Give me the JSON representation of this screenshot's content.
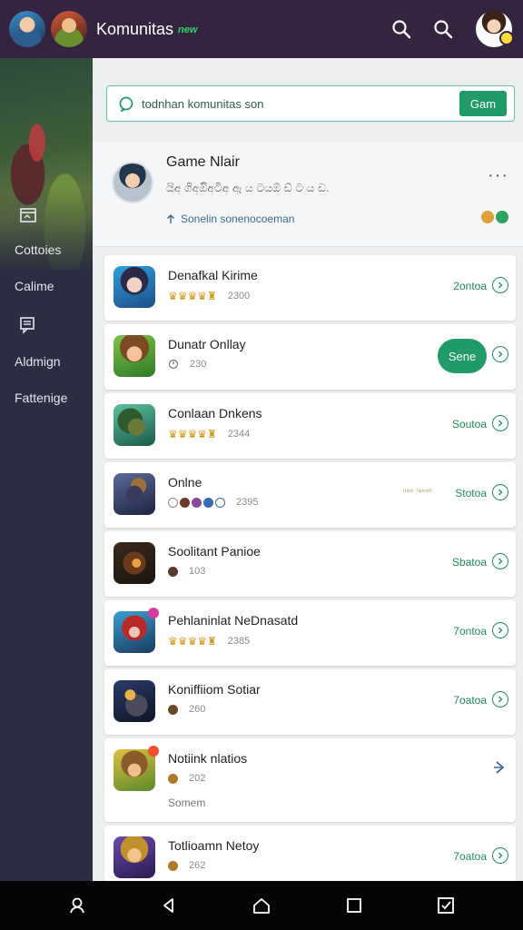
{
  "topbar": {
    "title": "Komunitas",
    "badge": "new"
  },
  "sidebar": {
    "items": [
      {
        "label": "Cottoies"
      },
      {
        "label": "Calime"
      },
      {
        "label": "Aldmign"
      },
      {
        "label": "Fattenige"
      }
    ]
  },
  "search": {
    "placeholder": "todnhan komunitas son",
    "button_label": "Gam"
  },
  "feature": {
    "title": "Game Nlair",
    "description": "යිඅ ගිඅඔිඅටිඅ ඇ ය ටයඕ ඩ් ට ය ඩ.",
    "subtitle": "Sonelin sonenocoeman",
    "more_label": "···"
  },
  "games": [
    {
      "name": "Denafkal Kirime",
      "count": "2300",
      "status": "2ontoa"
    },
    {
      "name": "Dunatr Onllay",
      "count": "230",
      "join_label": "Sene"
    },
    {
      "name": "Conlaan Dnkens",
      "count": "2344",
      "status": "Soutoa"
    },
    {
      "name": "Onlne",
      "count": "2395",
      "status": "Stotoa",
      "tag": "ᵒᵉᵒ ⁱᵃⁿⁿʰ"
    },
    {
      "name": "Soolitant Panioe",
      "count": "103",
      "status": "Sbatoa"
    },
    {
      "name": "Pehlaninlat NeDnasatd",
      "count": "2385",
      "status": "7ontoa"
    },
    {
      "name": "Koniffiiom Sotiar",
      "count": "260",
      "status": "7oatoa"
    },
    {
      "name": "Notiink nlatios",
      "count": "202",
      "extra": "Somem"
    },
    {
      "name": "Totlioamn Netoy",
      "count": "262",
      "status": "7oatoa"
    }
  ],
  "colors": {
    "topbar": "#34243f",
    "sidebar": "#2b2d40",
    "accent": "#1f9a68",
    "status_text": "#208a5d"
  }
}
